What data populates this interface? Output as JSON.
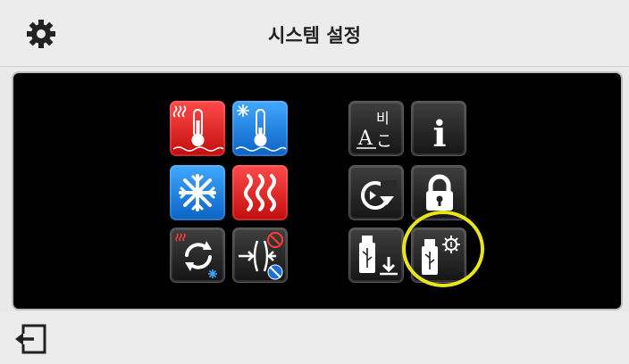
{
  "header": {
    "title": "시스템 설정",
    "icon": "gear-icon"
  },
  "tiles": {
    "thermo_hot": {
      "icon": "thermometer-heat-icon"
    },
    "thermo_cold": {
      "icon": "thermometer-cold-icon"
    },
    "cooling": {
      "icon": "snowflake-icon"
    },
    "heating": {
      "icon": "heat-waves-icon"
    },
    "cycle": {
      "icon": "heat-cool-cycle-icon"
    },
    "valve": {
      "icon": "valve-compress-icon"
    },
    "language": {
      "icon": "language-icon",
      "glyph_top": "비",
      "glyph_left": "A",
      "glyph_right": "こ"
    },
    "info": {
      "icon": "info-icon",
      "glyph": "i"
    },
    "reset": {
      "icon": "restore-icon"
    },
    "lock": {
      "icon": "lock-icon"
    },
    "usb_download": {
      "icon": "usb-download-icon"
    },
    "usb_settings": {
      "icon": "usb-settings-icon"
    }
  },
  "footer": {
    "exit_icon": "exit-icon"
  },
  "colors": {
    "accent_highlight": "#e7e61c",
    "red": "#e01919",
    "blue": "#1878e0"
  }
}
